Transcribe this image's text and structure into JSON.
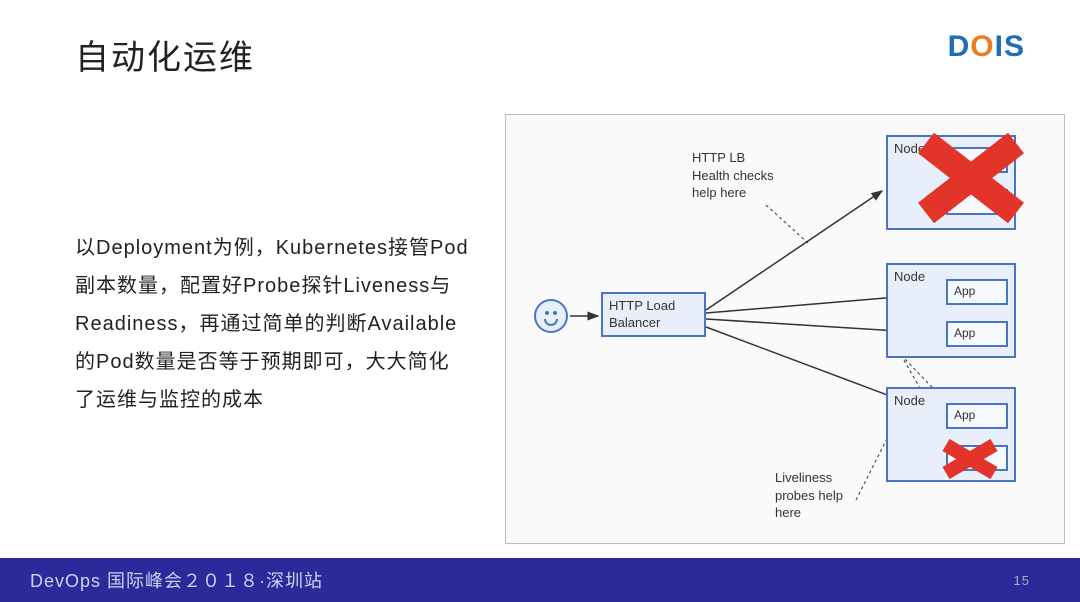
{
  "header": {
    "title": "自动化运维",
    "logo_text": "DOIS"
  },
  "body": {
    "paragraph": "以Deployment为例，Kubernetes接管Pod副本数量，配置好Probe探针Liveness与Readiness，再通过简单的判断Available的Pod数量是否等于预期即可，大大简化了运维与监控的成本"
  },
  "diagram": {
    "annot1": "HTTP LB Health checks help here",
    "annot2": "Liveliness probes help here",
    "lb": "HTTP Load Balancer",
    "node_label": "Node",
    "app_label": "App"
  },
  "footer": {
    "text": "DevOps 国际峰会２０１８·深圳站",
    "page": "15"
  }
}
